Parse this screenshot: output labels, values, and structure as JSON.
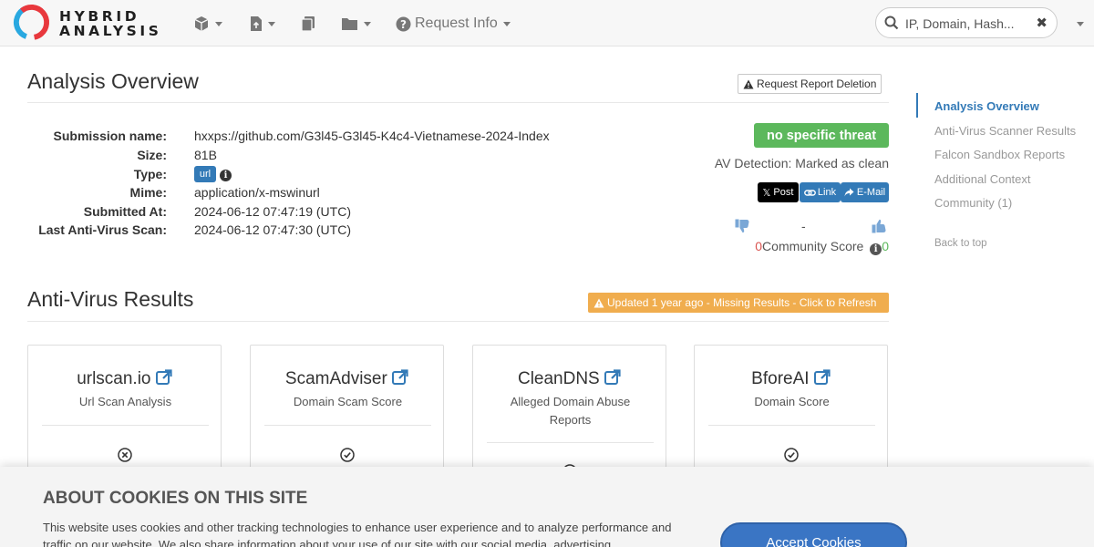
{
  "brand": {
    "line1": "HYBRID",
    "line2": "ANALYSIS"
  },
  "nav": {
    "request_info": "Request Info"
  },
  "search": {
    "placeholder": "IP, Domain, Hash..."
  },
  "overview": {
    "title": "Analysis Overview",
    "request_deletion": "Request Report Deletion",
    "rows": [
      {
        "label": "Submission name:",
        "value": "hxxps://github.com/G3l45-G3l45-K4c4-Vietnamese-2024-Index"
      },
      {
        "label": "Size:",
        "value": "81B"
      },
      {
        "label": "Type:",
        "value": "url"
      },
      {
        "label": "Mime:",
        "value": "application/x-mswinurl"
      },
      {
        "label": "Submitted At:",
        "value": "2024-06-12 07:47:19 (UTC)"
      },
      {
        "label": "Last Anti-Virus Scan:",
        "value": "2024-06-12 07:47:30 (UTC)"
      }
    ],
    "threat_label": "no specific threat",
    "av_detection": "AV Detection: Marked as clean",
    "share": {
      "post": "Post",
      "link": "Link",
      "email": "E-Mail"
    },
    "vote_dash": "-",
    "community": {
      "negative": "0",
      "label": "Community Score",
      "positive": "0"
    }
  },
  "antivirus": {
    "title": "Anti-Virus Results",
    "refresh_notice": "Updated 1 year ago - Missing Results - Click to Refresh",
    "cards": [
      {
        "name": "urlscan.io",
        "description": "Url Scan Analysis",
        "status_icon": "circle-x-icon"
      },
      {
        "name": "ScamAdviser",
        "description": "Domain Scam Score",
        "status_icon": "circle-check-icon"
      },
      {
        "name": "CleanDNS",
        "description": "Alleged Domain Abuse Reports",
        "status_icon": "circle-check-icon"
      },
      {
        "name": "BforeAI",
        "description": "Domain Score",
        "status_icon": "circle-check-icon"
      }
    ]
  },
  "sidebar": {
    "items": [
      {
        "label": "Analysis Overview",
        "active": true
      },
      {
        "label": "Anti-Virus Scanner Results",
        "active": false
      },
      {
        "label": "Falcon Sandbox Reports",
        "active": false
      },
      {
        "label": "Additional Context",
        "active": false
      },
      {
        "label": "Community (1)",
        "active": false
      }
    ],
    "back_to_top": "Back to top"
  },
  "cookies": {
    "title": "ABOUT COOKIES ON THIS SITE",
    "text": "This website uses cookies and other tracking technologies to enhance user experience and to analyze performance and traffic on our website. We also share information about your use of our site with our social media, advertising",
    "accept": "Accept Cookies"
  },
  "colors": {
    "accent": "#337ab7",
    "threat_green": "#5cb85c",
    "warning": "#f0ad4e",
    "negative": "#d9534f"
  }
}
